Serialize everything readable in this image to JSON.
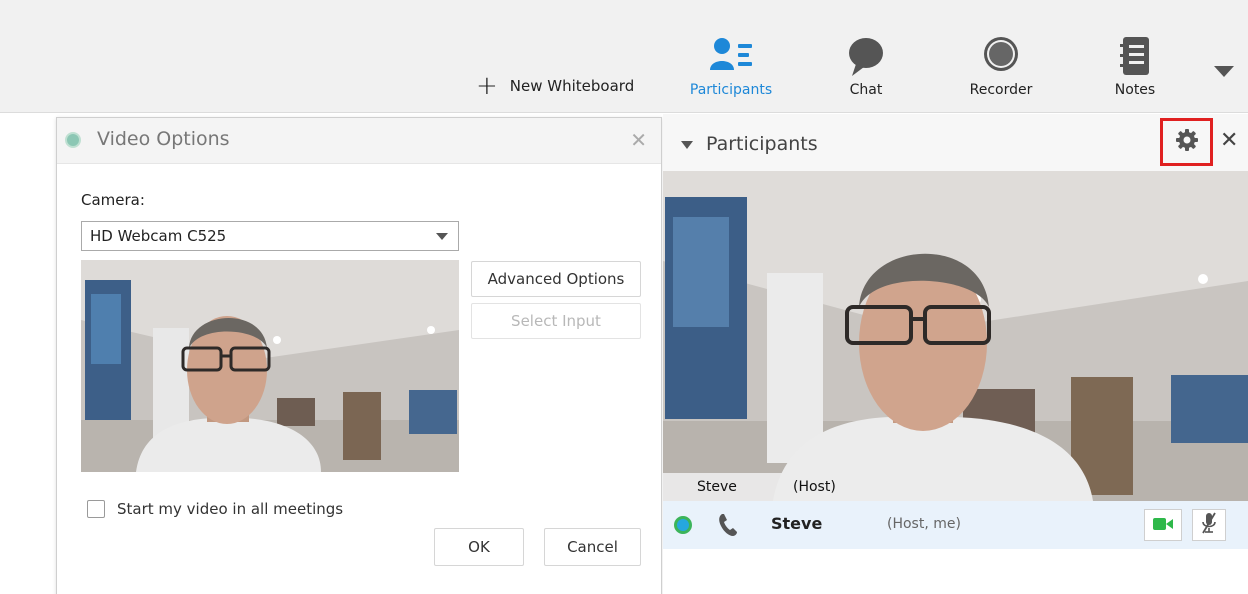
{
  "toolbar": {
    "new_whiteboard_label": "New Whiteboard",
    "items": [
      {
        "label": "Participants",
        "icon": "participants-icon",
        "active": true
      },
      {
        "label": "Chat",
        "icon": "chat-icon"
      },
      {
        "label": "Recorder",
        "icon": "recorder-icon"
      },
      {
        "label": "Notes",
        "icon": "notes-icon"
      }
    ],
    "accent_color": "#1e88d8"
  },
  "video_options": {
    "title": "Video Options",
    "camera_label": "Camera:",
    "camera_selected": "HD Webcam C525",
    "advanced_options_label": "Advanced Options",
    "select_input_label": "Select Input",
    "start_video_label": "Start my video in all meetings",
    "start_video_checked": false,
    "ok_label": "OK",
    "cancel_label": "Cancel"
  },
  "participants": {
    "title": "Participants",
    "video_name": "Steve",
    "video_role": "(Host)",
    "row_name": "Steve",
    "row_meta": "(Host, me)",
    "highlight_color": "#e02020"
  }
}
